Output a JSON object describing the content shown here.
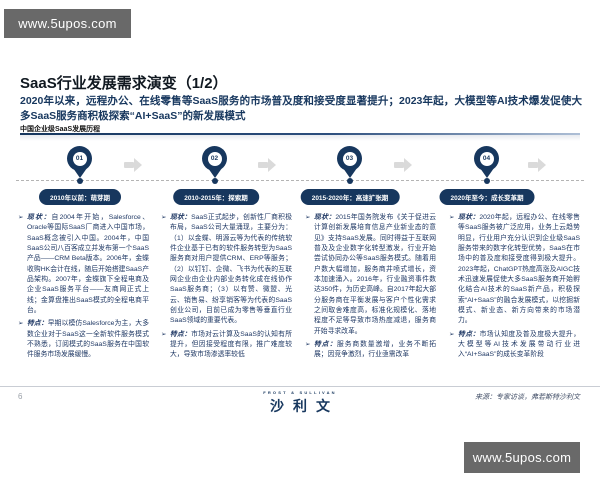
{
  "watermark": {
    "text": "www.5upos.com"
  },
  "slide": {
    "title": "SaaS行业发展需求演变（1/2）",
    "subtitle": "2020年以来，远程办公、在线零售等SaaS服务的市场普及度和接受度显著提升；2023年起，大模型等AI技术爆发促使大多SaaS服务商积极探索“AI+SaaS”的新发展模式",
    "section_label": "中国企业级SaaS发展历程",
    "bullet_glyph": "➢",
    "stages": [
      {
        "num": "01",
        "pill": "2010年以前：萌芽期",
        "bullets": [
          {
            "label": "现状：",
            "text": "自2004年开始，Salesforce、Oracle等国际SaaS厂商进入中国市场，SaaS概念被引入中国。2004年，中国SaaS公司八百客成立并发布第一个SaaS产品——CRM Beta版本。2006年，金蝶收购HK会计在线，随后开始搭建SaaS产品架构。2007年，金蝶旗下全程电商及企业SaaS服务平台——友商网正式上线；金算盘推出SaaS模式的全程电商平台。"
          },
          {
            "label": "特点：",
            "text": "早期以模仿Salesforce为主，大多数企业对于SaaS这一全新软件服务模式不熟悉，订阅模式的SaaS服务在中国软件服务市场发展缓慢。"
          }
        ]
      },
      {
        "num": "02",
        "pill": "2010-2015年：探索期",
        "bullets": [
          {
            "label": "现状：",
            "text": "SaaS正式起步，创新性厂商积极布局，SaaS公司大量涌现，主要分为：（1）以金蝶、明源云等为代表的传统软件企业基于已有的软件服务转型为SaaS服务商对用户提供CRM、ERP等服务；（2）以钉钉、企微、飞书为代表的互联网企业由企业内部业务转化成在线协作SaaS服务商；（3）以有赞、微盟、光云、销售易、纷享销客等为代表的SaaS创业公司，目前已成为零售等垂直行业SaaS领域的重要代表。"
          },
          {
            "label": "特点：",
            "text": "市场对云计算及SaaS的认知有所提升，但因接受程度有限，推广难度较大，导致市场渗透率较低"
          }
        ]
      },
      {
        "num": "03",
        "pill": "2015-2020年：高速扩张期",
        "bullets": [
          {
            "label": "现状：",
            "text": "2015年国务院发布《关于促进云计算创新发展培育信息产业新业态的意见》支持SaaS发展。同时得益于互联网普及及企业数字化转型激发，行业开始尝试协同办公等SaaS服务模式。随着用户数大幅增加，服务商井喷式增长，资本加速涌入。2016年，行业融资事件数达350件，为历史高峰。自2017年起大部分服务商在平衡发展与客户个性化需求之间取舍难度高，标准化规模化、落地程度不足等导致市场热度减退，服务商开始寻求改革。"
          },
          {
            "label": "特点：",
            "text": "服务商数量激增，业务不断拓展；因竞争激烈，行业亟需改革"
          }
        ]
      },
      {
        "num": "04",
        "pill": "2020年至今：成长变革期",
        "bullets": [
          {
            "label": "现状：",
            "text": "2020年起，远程办公、在线零售等SaaS服务被广泛应用，业务上云趋势明显，行业用户充分认识到企业级SaaS服务带来的数字化转型优势，SaaS在市场中的普及度和接受度得到极大提升。2023年起，ChatGPT热度高涨及AIGC技术迅速发展促使大多SaaS服务商开始孵化结合AI技术的SaaS新产品，积极探索“AI+SaaS”的融合发展模式，以挖掘新模式、新业态、新方向带来的市场潜力。"
          },
          {
            "label": "特点：",
            "text": "市场认知度及普及度极大提升，大模型等AI技术发展带动行业进入“AI+SaaS”的成长变革阶段"
          }
        ]
      }
    ],
    "footer": {
      "page_number": "6",
      "logo_small": "FROST & SULLIVAN",
      "logo_text": "沙利文",
      "source": "来源：专家访谈，弗若斯特沙利文"
    }
  },
  "colors": {
    "navy": "#17375E",
    "body_text": "#1F3864",
    "arrow_gray": "#dadada",
    "watermark_bg": "#696969"
  }
}
